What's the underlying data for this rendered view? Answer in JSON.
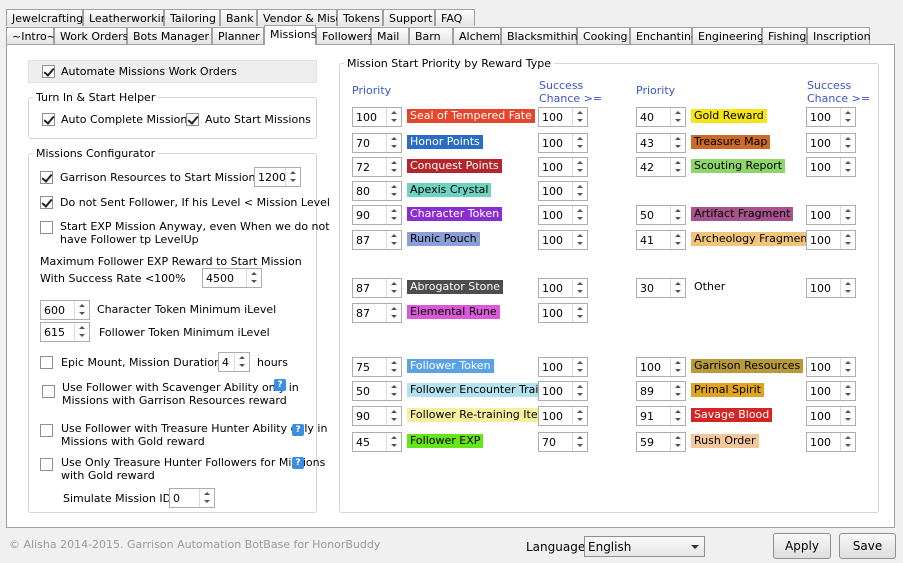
{
  "tabs_row1": [
    "Jewelcrafting",
    "Leatherworking",
    "Tailoring",
    "Bank",
    "Vendor & Misc",
    "Tokens",
    "Support",
    "FAQ"
  ],
  "tabs_row2": [
    "~Intro~",
    "Work Orders",
    "Bots Manager",
    "Planner",
    "Missions",
    "Followers",
    "Mail",
    "Barn",
    "Alchemy",
    "Blacksmithing",
    "Cooking",
    "Enchanting",
    "Engineering",
    "Fishing",
    "Inscription"
  ],
  "active_tab": "Missions",
  "automate": {
    "label": "Automate Missions Work Orders",
    "checked": true
  },
  "turnin": {
    "title": "Turn In & Start Helper",
    "auto_complete": "Auto Complete Missions",
    "auto_start": "Auto Start Missions"
  },
  "config": {
    "title": "Missions Configurator",
    "garrison_resources_label": "Garrison Resources to Start Missions >=",
    "garrison_resources_value": "1200",
    "no_follower_label": "Do not Sent Follower, If his Level < Mission Level",
    "start_exp_line1": "Start EXP Mission Anyway, even When we do not",
    "start_exp_line2": "have Follower tp LevelUp",
    "max_exp_line1": "Maximum Follower EXP Reward to Start Mission",
    "max_exp_line2": "With Success Rate  <100%",
    "max_exp_value": "4500",
    "char_token_value": "600",
    "char_token_label": "Character Token Minimum iLevel",
    "follower_token_value": "615",
    "follower_token_label": "Follower Token Minimum iLevel",
    "epic_mount_label": "Epic Mount, Mission Duration >=",
    "epic_mount_value": "4",
    "epic_mount_unit": "hours",
    "scavenger_line1": "Use Follower with Scavenger Ability only in",
    "scavenger_line2": "Missions with Garrison Resources reward",
    "treasure_line1": "Use Follower with Treasure Hunter Ability only in",
    "treasure_line2": "Missions with Gold reward",
    "only_treasure_line1": "Use Only Treasure Hunter Followers for Missions",
    "only_treasure_line2": "with Gold reward",
    "simulate_label": "Simulate Mission ID:",
    "simulate_value": "0",
    "help_glyph": "?"
  },
  "priority": {
    "title": "Mission Start Priority by Reward Type",
    "priority_header": "Priority",
    "success_header_line1": "Success",
    "success_header_line2": "Chance >=",
    "left": [
      {
        "p": "100",
        "name": "Seal of Tempered Fate",
        "color": "#e5452a",
        "text": "#fff",
        "s": "100"
      },
      {
        "p": "70",
        "name": "Honor Points",
        "color": "#2b6cc4",
        "text": "#fff",
        "s": "100"
      },
      {
        "p": "72",
        "name": "Conquest Points",
        "color": "#b3262b",
        "text": "#fff",
        "s": "100"
      },
      {
        "p": "80",
        "name": "Apexis Crystal",
        "color": "#6fd3c1",
        "text": "#000",
        "s": "100"
      },
      {
        "p": "90",
        "name": "Character Token",
        "color": "#8a2ed0",
        "text": "#fff",
        "s": "100"
      },
      {
        "p": "87",
        "name": "Runic Pouch",
        "color": "#8c9ed8",
        "text": "#000",
        "s": "100"
      },
      {
        "p": "87",
        "name": "Abrogator Stone",
        "color": "#4d4d4d",
        "text": "#fff",
        "s": "100"
      },
      {
        "p": "87",
        "name": "Elemental Rune",
        "color": "#d85ad8",
        "text": "#000",
        "s": "100"
      },
      {
        "p": "75",
        "name": "Follower Token",
        "color": "#5aa2e6",
        "text": "#fff",
        "s": "100"
      },
      {
        "p": "50",
        "name": "Follower Encounter Trait",
        "color": "#b3e2ee",
        "text": "#000",
        "s": "100"
      },
      {
        "p": "90",
        "name": "Follower Re-training Items",
        "color": "#f5f0a0",
        "text": "#000",
        "s": "100"
      },
      {
        "p": "45",
        "name": "Follower EXP",
        "color": "#66e61a",
        "text": "#000",
        "s": "70"
      }
    ],
    "right": [
      {
        "p": "40",
        "name": "Gold Reward",
        "color": "#f7e516",
        "text": "#000",
        "s": "100"
      },
      {
        "p": "43",
        "name": "Treasure Map",
        "color": "#cc6a2a",
        "text": "#000",
        "s": "100"
      },
      {
        "p": "42",
        "name": "Scouting Report",
        "color": "#8ed66a",
        "text": "#000",
        "s": "100"
      },
      {
        "p": "50",
        "name": "Artifact Fragment",
        "color": "#a6528c",
        "text": "#000",
        "s": "100"
      },
      {
        "p": "41",
        "name": "Archeology Fragments",
        "color": "#f2c47a",
        "text": "#000",
        "s": "100"
      },
      {
        "p": "30",
        "name": "Other",
        "color": "",
        "text": "#000",
        "s": "100"
      },
      {
        "p": "100",
        "name": "Garrison Resources",
        "color": "#b89a3a",
        "text": "#000",
        "s": "100"
      },
      {
        "p": "89",
        "name": "Primal Spirit",
        "color": "#e0a51e",
        "text": "#000",
        "s": "100"
      },
      {
        "p": "91",
        "name": "Savage Blood",
        "color": "#d42525",
        "text": "#fff",
        "s": "100"
      },
      {
        "p": "59",
        "name": "Rush Order",
        "color": "#f4c89a",
        "text": "#000",
        "s": "100"
      }
    ]
  },
  "footer": {
    "copyright": "© Alisha 2014-2015. Garrison Automation BotBase for HonorBuddy",
    "language_label": "Language",
    "language_value": "English",
    "apply": "Apply",
    "save": "Save"
  }
}
